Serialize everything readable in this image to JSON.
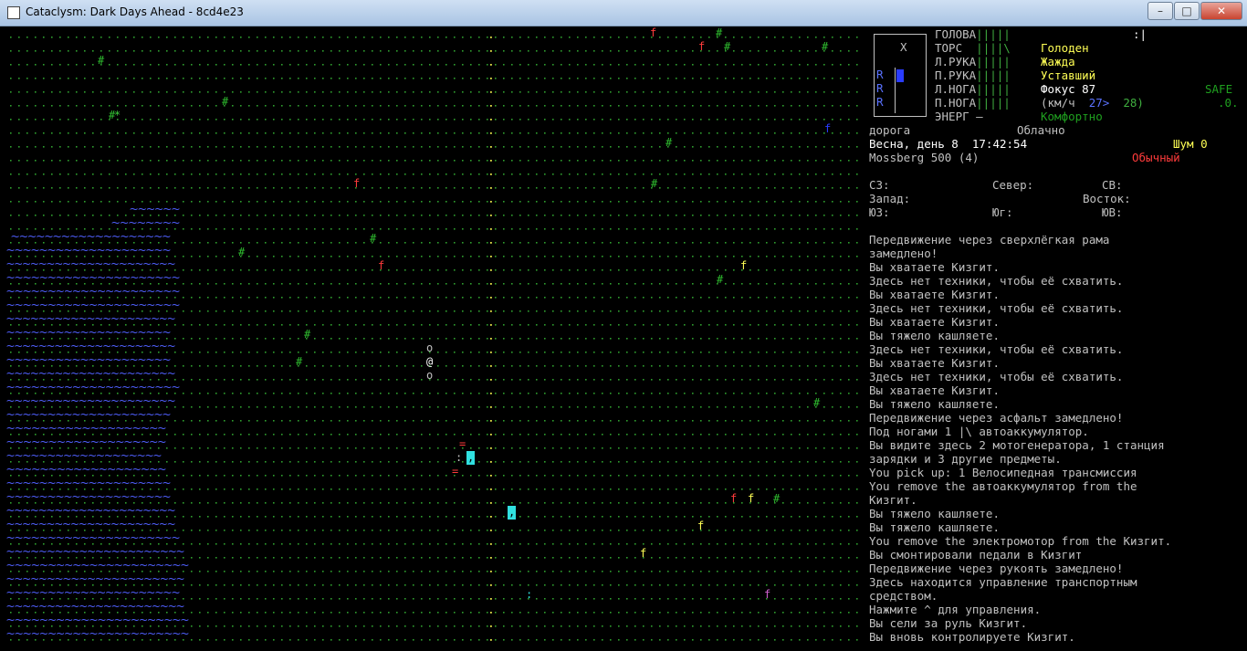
{
  "window": {
    "title": "Cataclysm: Dark Days Ahead - 8cd4e23",
    "min": "–",
    "max": "□",
    "close": "✕"
  },
  "status": {
    "bodyparts": [
      {
        "label": "ГОЛОВА",
        "bar": "|||||"
      },
      {
        "label": "ТОРС",
        "bar": "||||\\"
      },
      {
        "label": "Л.РУКА",
        "bar": "|||||"
      },
      {
        "label": "П.РУКА",
        "bar": "|||||"
      },
      {
        "label": "Л.НОГА",
        "bar": "|||||"
      },
      {
        "label": "П.НОГА",
        "bar": "|||||"
      }
    ],
    "energy": "ЭНЕРГ —",
    "cursor_mark": ":|",
    "hunger": "Голоден",
    "thirst": "Жажда",
    "fatigue": "Уставший",
    "focus": "Фокус 87",
    "speed_label": "(км/ч",
    "speed_current": "27>",
    "speed_max": "28)",
    "safe": "SAFE",
    "safe_value": ".0.",
    "comfort": "Комфортно",
    "minimap_x": "X",
    "minimap_r": [
      "R",
      "R",
      "R"
    ]
  },
  "env": {
    "terrain": "дорога",
    "weather": "Облачно",
    "date": "Весна, день 8  17:42:54",
    "noise": "Шум 0",
    "weapon": "Mossberg 500 (4)",
    "mode": "Обычный"
  },
  "compass": {
    "nw": "СЗ:",
    "n": "Север:",
    "ne": "СВ:",
    "w": "Запад:",
    "e": "Восток:",
    "sw": "ЮЗ:",
    "s": "Юг:",
    "se": "ЮВ:"
  },
  "messages": [
    "Передвижение через сверхлёгкая рама",
    "замедлено!",
    "Вы хватаете Кизгит.",
    "Здесь нет техники, чтобы её схватить.",
    "Вы хватаете Кизгит.",
    "Здесь нет техники, чтобы её схватить.",
    "Вы хватаете Кизгит.",
    "Вы тяжело кашляете.",
    "Здесь нет техники, чтобы её схватить.",
    "Вы хватаете Кизгит.",
    "Здесь нет техники, чтобы её схватить.",
    "Вы хватаете Кизгит.",
    "Вы тяжело кашляете.",
    "Передвижение через асфальт замедлено!",
    "Под ногами 1 |\\ автоаккумулятор.",
    "Вы видите здесь 2 мотогенератора, 1 станция",
    "зарядки и 3 другие предметы.",
    "You pick up: 1 Велосипедная трансмиссия",
    "You remove the автоаккумулятор from the",
    "Кизгит.",
    "Вы тяжело кашляете.",
    "Вы тяжело кашляете.",
    "You remove the электромотор from the Кизгит.",
    "Вы смонтировали педали в Кизгит",
    "Передвижение через рукоять замедлено!",
    "Здесь находится управление транспортным",
    "средством.",
    "Нажмите ^ для управления.",
    "Вы сели за руль Кизгит.",
    "Вы вновь контролируете Кизгит."
  ],
  "map": {
    "player": "@",
    "road_char": ".",
    "water_char": "~",
    "tree_char": "#",
    "colors": {
      "grass": "#2e9e2e",
      "road": "#e5e04a",
      "water": "#5060ff",
      "tree": "#2fbf2f"
    }
  }
}
